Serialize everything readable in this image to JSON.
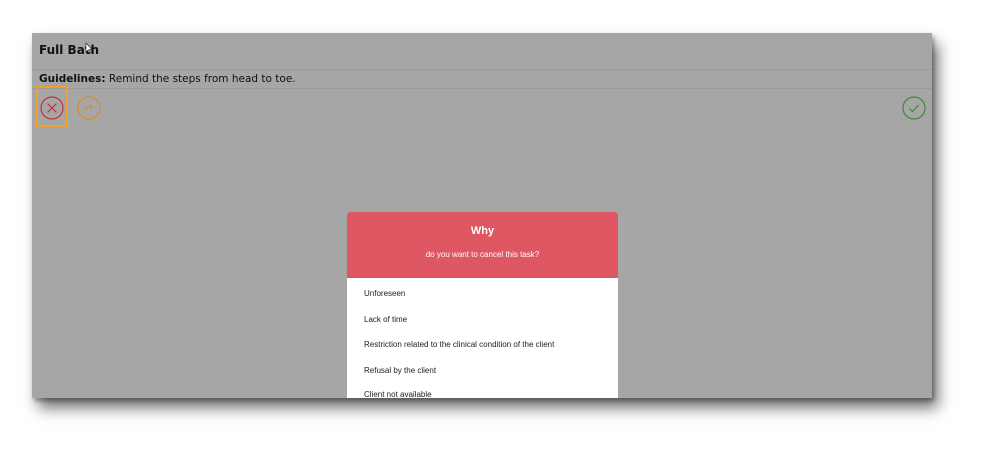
{
  "task": {
    "title": "Full Bath",
    "guidelines_label": "Guidelines:",
    "guidelines_text": " Remind the steps from head to toe."
  },
  "toolbar": {
    "cancel_icon": "close-circle-icon",
    "forward_icon": "forward-arrow-circle-icon",
    "done_icon": "check-circle-icon"
  },
  "colors": {
    "overlay": "#a6a6a6",
    "modal_header": "#e05764",
    "cancel": "#c0323f",
    "forward": "#d98a2b",
    "done": "#3c8a3c",
    "highlight": "#f0a030"
  },
  "cancel_dialog": {
    "title": "Why",
    "subtitle": "do you want to cancel this task?",
    "reasons": [
      "Unforeseen",
      "Lack of time",
      "Restriction related to the clinical condition of the client",
      "Refusal by the client",
      "Client not available"
    ]
  }
}
